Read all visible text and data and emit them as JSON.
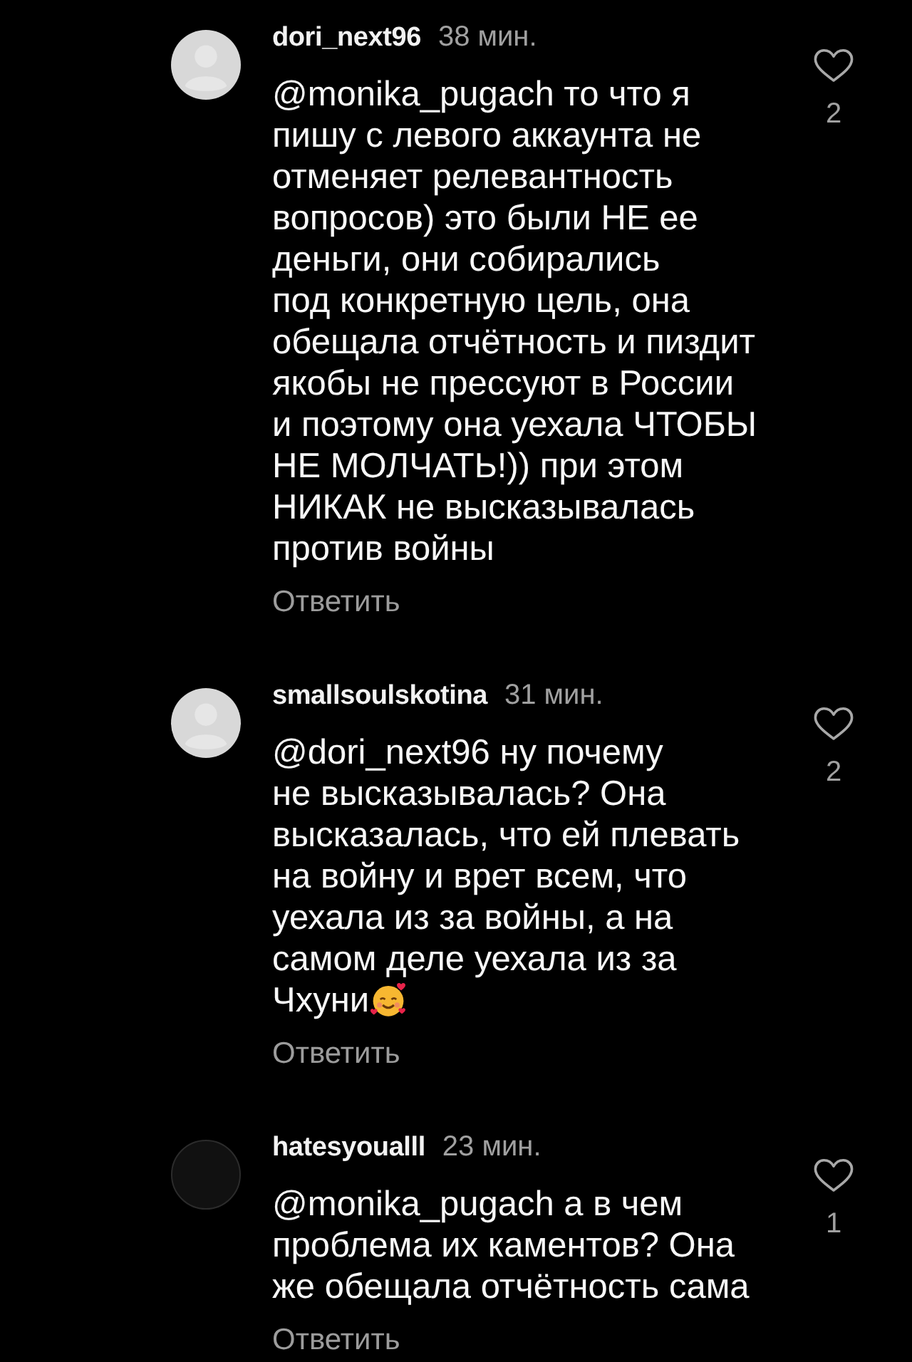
{
  "comments": [
    {
      "username": "dori_next96",
      "time": "38 мин.",
      "avatar": {
        "kind": "placeholder"
      },
      "text": "@monika_pugach то что я\nпишу с левого аккаунта не\nотменяет релевантность\nвопросов) это были НЕ ее\nденьги, они собирались\nпод конкретную цель, она\nобещала отчётность и пиздит\nякобы не прессуют в России\nи поэтому она уехала ЧТОБЫ\nНЕ МОЛЧАТЬ!)) при этом\nНИКАК не высказывалась\nпротив войны",
      "emoji_after_text": false,
      "reply": "Ответить",
      "liked": false,
      "likes": "2"
    },
    {
      "username": "smallsoulskotina",
      "time": "31 мин.",
      "avatar": {
        "kind": "placeholder"
      },
      "text": "@dori_next96 ну почему\nне высказывалась? Она\nвысказалась, что ей плевать\nна войну и врет всем, что\nуехала из за войны, а на\nсамом деле уехала из за\nЧхуни",
      "emoji_after_text": true,
      "reply": "Ответить",
      "liked": false,
      "likes": "2"
    },
    {
      "username": "hatesyoualll",
      "time": "23 мин.",
      "avatar": {
        "kind": "dark"
      },
      "text": "@monika_pugach а в чем\nпроблема их каментов? Она\nже обещала отчётность сама",
      "emoji_after_text": false,
      "reply": "Ответить",
      "liked": false,
      "likes": "1"
    }
  ]
}
